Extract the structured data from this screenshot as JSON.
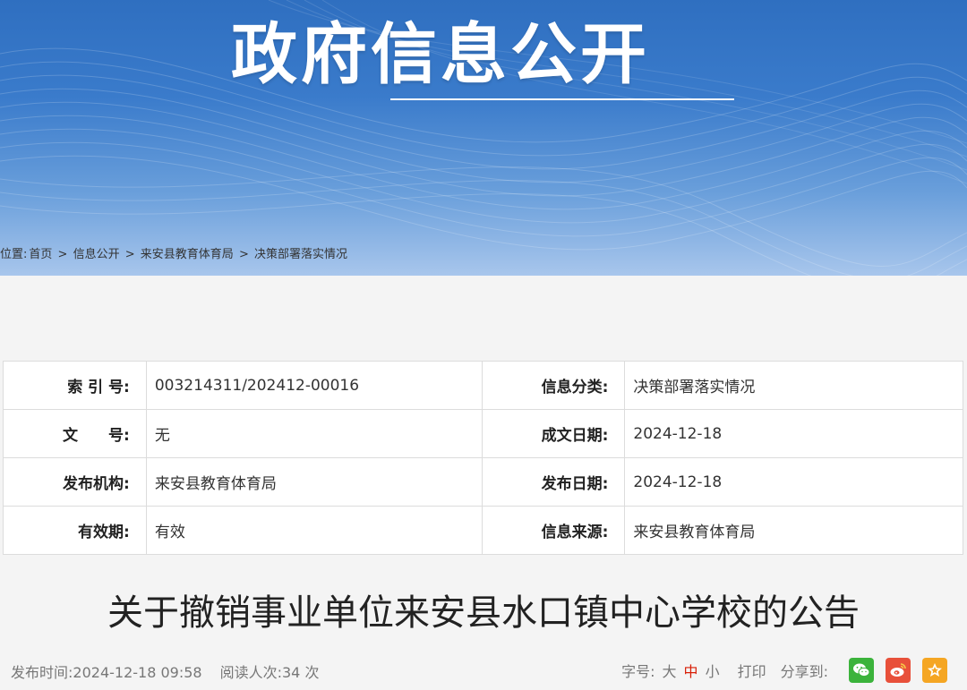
{
  "banner": {
    "title": "政府信息公开"
  },
  "breadcrumb": {
    "prefix": "位置:",
    "items": [
      "首页",
      "信息公开",
      "来安县教育体育局",
      "决策部署落实情况"
    ],
    "separator": ">"
  },
  "meta": {
    "rows": [
      {
        "label1": "索 引 号:",
        "value1": "003214311/202412-00016",
        "label2": "信息分类:",
        "value2": "决策部署落实情况"
      },
      {
        "label1": "文　　号:",
        "value1": "无",
        "label2": "成文日期:",
        "value2": "2024-12-18"
      },
      {
        "label1": "发布机构:",
        "value1": "来安县教育体育局",
        "label2": "发布日期:",
        "value2": "2024-12-18"
      },
      {
        "label1": "有效期:",
        "value1": "有效",
        "label2": "信息来源:",
        "value2": "来安县教育体育局"
      }
    ]
  },
  "article": {
    "title": "关于撤销事业单位来安县水口镇中心学校的公告",
    "publish_time_label": "发布时间:",
    "publish_time": "2024-12-18 09:58",
    "views_label": "阅读人次:",
    "views": "34 次"
  },
  "tools": {
    "font_label": "字号:",
    "font_large": "大",
    "font_medium": "中",
    "font_small": "小",
    "print_label": "打印",
    "share_label": "分享到:",
    "share_icons": [
      "wechat-icon",
      "weibo-icon",
      "favorite-icon"
    ],
    "colors": {
      "wechat": "#3bb33b",
      "weibo": "#e8503a",
      "favorite": "#f5a623",
      "active_size": "#d81e06"
    }
  }
}
